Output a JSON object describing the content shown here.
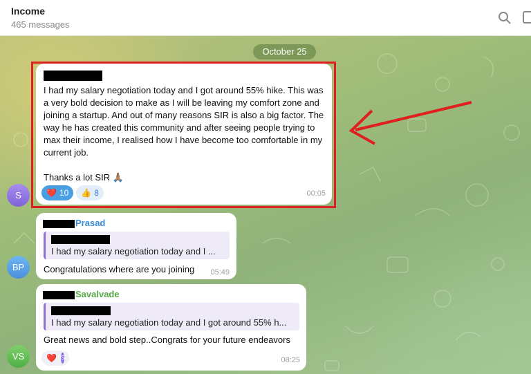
{
  "header": {
    "title": "Income",
    "subtitle": "465 messages",
    "icons": [
      "search-icon",
      "panel-icon"
    ]
  },
  "chat": {
    "date_separator": "October 25",
    "messages": [
      {
        "avatar_initials": "S",
        "text": "I had my salary negotiation today and I got around 55% hike. This was a very bold decision to make as I will be leaving my comfort zone and joining a startup. And out of many reasons SIR is also a big factor. The way he has created this community and after seeing people trying to max their income, I realised how I have become too comfortable in my current job.\n\nThanks a lot SIR 🙏🏽",
        "reactions": [
          {
            "emoji": "❤️",
            "count": "10"
          },
          {
            "emoji": "👍",
            "count": "8"
          }
        ],
        "time": "00:05"
      },
      {
        "avatar_initials": "BP",
        "sender": "Prasad",
        "quote": "I had my salary negotiation today and I ...",
        "text": "Congratulations where are you joining",
        "time": "05:49"
      },
      {
        "avatar_initials": "VS",
        "sender": "Savalvade",
        "quote": "I had my salary negotiation today and I got around 55% h...",
        "text": "Great news and bold step..Congrats for your future endeavors",
        "reactions": [
          {
            "emoji": "❤️",
            "reactor": "S"
          }
        ],
        "time": "08:25"
      }
    ]
  },
  "colors": {
    "highlight": "#e02020",
    "accent": "#4a9fe3",
    "quote_bar": "#8b6fd6"
  }
}
